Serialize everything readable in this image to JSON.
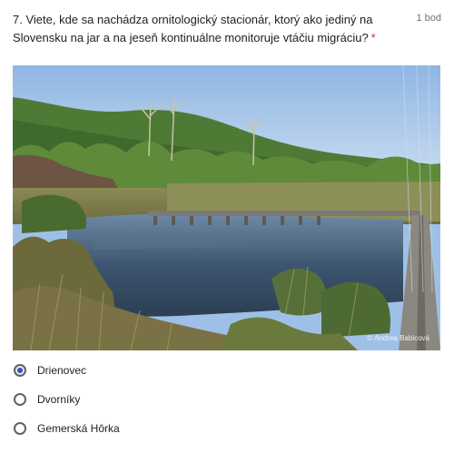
{
  "question": {
    "number_text": "7. Viete, kde sa nachádza ornitologický stacionár, ktorý ako jediný na Slovensku na jar a na jeseň kontinuálne monitoruje vtáčiu migráciu?",
    "required_mark": "*",
    "points": "1 bod"
  },
  "image": {
    "credit": "© Andrea Babicová"
  },
  "options": [
    {
      "label": "Drienovec",
      "selected": true
    },
    {
      "label": "Dvorníky",
      "selected": false
    },
    {
      "label": "Gemerská Hôrka",
      "selected": false
    }
  ]
}
